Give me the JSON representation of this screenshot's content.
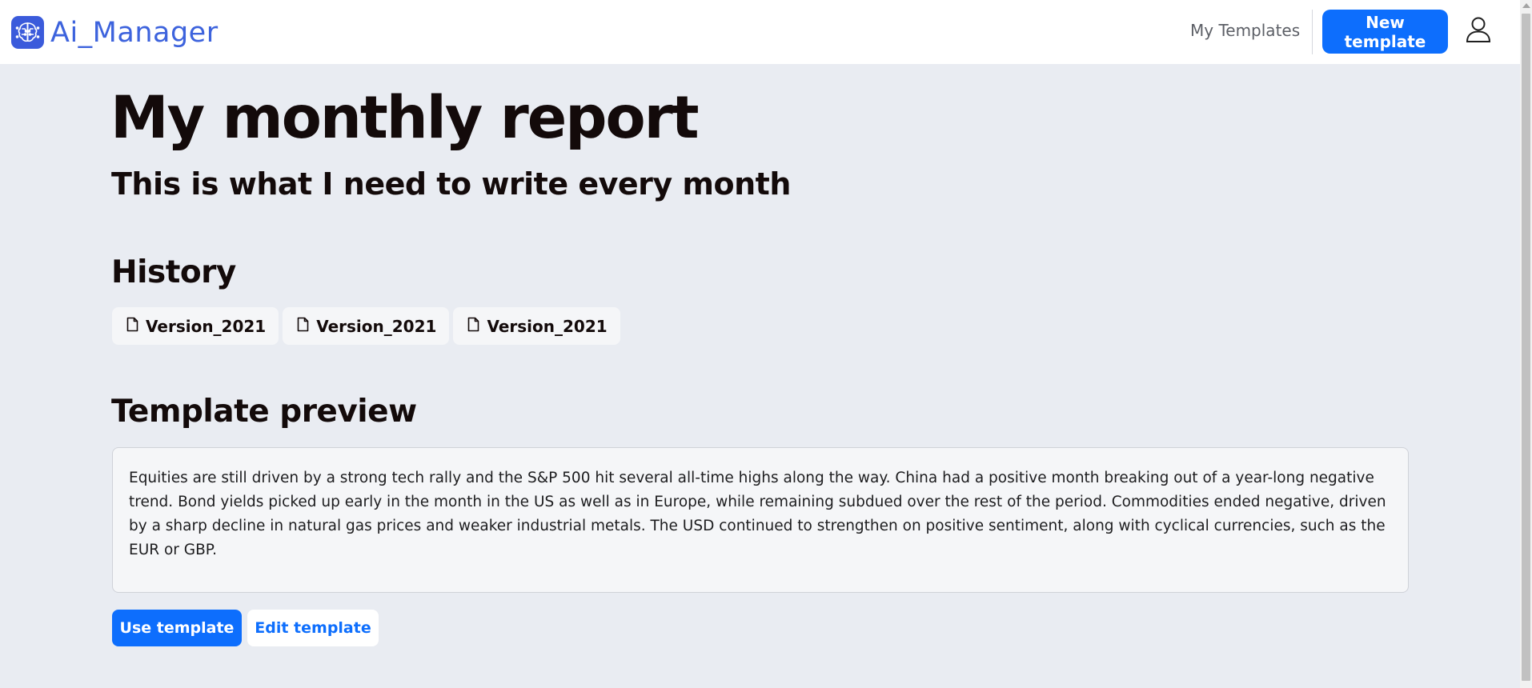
{
  "navbar": {
    "brand": "Ai_Manager",
    "brand_icon": "brain-circuit-icon",
    "my_templates_label": "My Templates",
    "new_template_label": "New template",
    "user_icon": "user-icon"
  },
  "page": {
    "title": "My monthly report",
    "subtitle": "This is what I need to write every month"
  },
  "history": {
    "heading": "History",
    "items": [
      {
        "label": "Version_2021",
        "icon": "file-icon"
      },
      {
        "label": "Version_2021",
        "icon": "file-icon"
      },
      {
        "label": "Version_2021",
        "icon": "file-icon"
      }
    ]
  },
  "preview": {
    "heading": "Template preview",
    "text": "Equities are still driven by a strong tech rally and the S&P 500 hit several all-time highs along the way. China had a positive month breaking out of a year-long negative trend. Bond yields picked up early in the month in the US as well as in Europe, while remaining subdued over the rest of the period. Commodities ended negative, driven by a sharp decline in natural gas prices and weaker industrial metals. The USD continued to strengthen on positive sentiment, along with cyclical currencies, such as the EUR or GBP."
  },
  "actions": {
    "use_label": "Use template",
    "edit_label": "Edit template"
  },
  "colors": {
    "primary": "#0d6efd",
    "brand": "#3d63dd",
    "background": "#e9ecf2"
  }
}
